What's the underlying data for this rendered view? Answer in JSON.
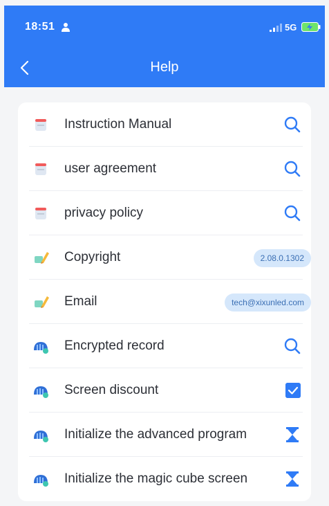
{
  "status_bar": {
    "time": "18:51",
    "network": "5G"
  },
  "nav": {
    "title": "Help"
  },
  "colors": {
    "primary": "#2f7bf6",
    "pill_bg": "#d5e7fb",
    "background": "#f4f5f7"
  },
  "rows": [
    {
      "label": "Instruction Manual",
      "icon": "document-icon",
      "action": "search-icon"
    },
    {
      "label": "user agreement",
      "icon": "document-icon",
      "action": "search-icon"
    },
    {
      "label": "privacy policy",
      "icon": "document-icon",
      "action": "search-icon"
    },
    {
      "label": "Copyright",
      "icon": "pencil-icon",
      "value": "2.08.0.1302"
    },
    {
      "label": "Email",
      "icon": "pencil-icon",
      "value": "tech@xixunled.com"
    },
    {
      "label": "Encrypted record",
      "icon": "lock-screen-icon",
      "action": "search-icon"
    },
    {
      "label": "Screen discount",
      "icon": "lock-screen-icon",
      "checked": true
    },
    {
      "label": "Initialize the advanced program",
      "icon": "lock-screen-icon",
      "action": "hourglass-icon"
    },
    {
      "label": "Initialize the magic cube screen",
      "icon": "lock-screen-icon",
      "action": "hourglass-icon"
    }
  ]
}
